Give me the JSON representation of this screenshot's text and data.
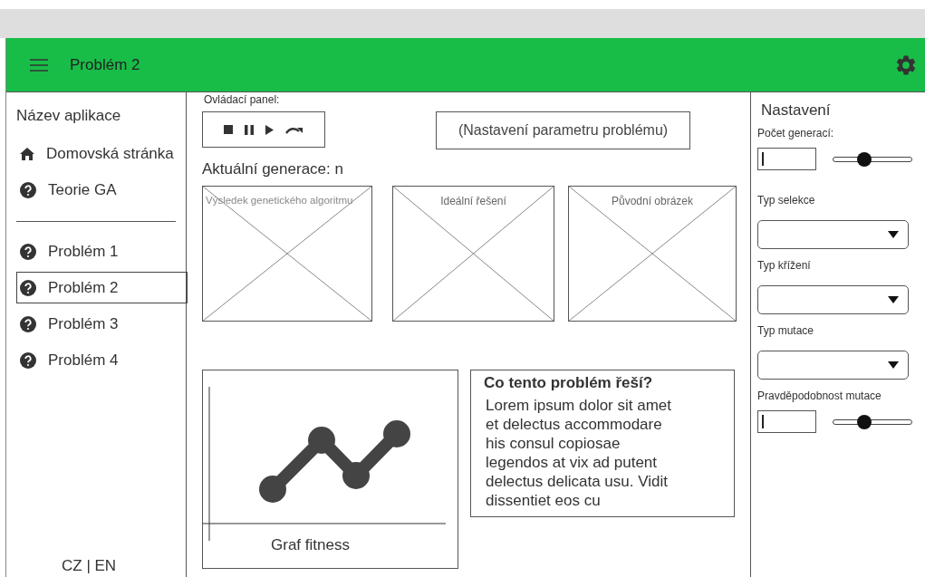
{
  "header": {
    "title": "Problém 2"
  },
  "sidebar": {
    "app_name": "Název aplikace",
    "top_items": [
      {
        "label": "Domovská stránka",
        "kind": "home",
        "selected": false
      },
      {
        "label": "Teorie GA",
        "kind": "help",
        "selected": false
      }
    ],
    "problem_items": [
      {
        "label": "Problém 1",
        "kind": "help",
        "selected": false
      },
      {
        "label": "Problém 2",
        "kind": "help",
        "selected": true
      },
      {
        "label": "Problém 3",
        "kind": "help",
        "selected": false
      },
      {
        "label": "Problém 4",
        "kind": "help",
        "selected": false
      }
    ],
    "language": "CZ | EN"
  },
  "main": {
    "control_panel_label": "Ovládací panel:",
    "controls": [
      {
        "kind": "stop"
      },
      {
        "kind": "pause"
      },
      {
        "kind": "play"
      },
      {
        "kind": "redo"
      }
    ],
    "parameter_button": "(Nastavení parametru problému)",
    "generation": "Aktuální generace: n",
    "images": [
      {
        "caption": "Výsledek genetického algoritmu"
      },
      {
        "caption": "Ideální řešení"
      },
      {
        "caption": "Původní obrázek"
      }
    ],
    "chart_caption": "Graf fitness",
    "info": {
      "title": "Co tento problém řeší?",
      "text": "Lorem ipsum dolor sit amet et delectus accommodare his consul copiosae legendos at vix ad putent delectus delicata usu. Vidit dissentiet eos cu"
    }
  },
  "settings": {
    "title": "Nastavení",
    "items": [
      {
        "kind": "slider",
        "label": "Počet generací:",
        "level": 0.4
      },
      {
        "kind": "select",
        "label": "Typ selekce"
      },
      {
        "kind": "select",
        "label": "Typ křížení"
      },
      {
        "kind": "select",
        "label": "Typ mutace"
      },
      {
        "kind": "slider",
        "label": "Pravděpodobnost mutace",
        "level": 0.4
      }
    ]
  }
}
